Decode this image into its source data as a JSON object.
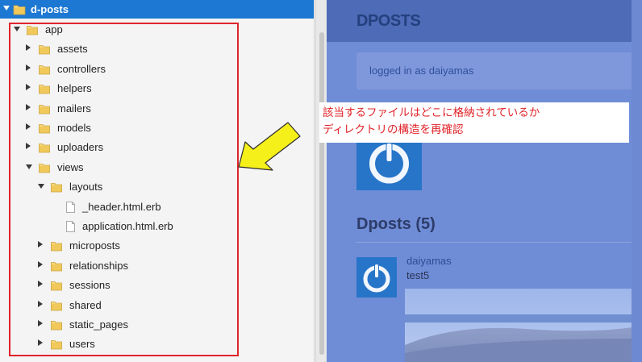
{
  "tree": {
    "root": {
      "label": "d-posts"
    },
    "nodes": [
      {
        "label": "app",
        "type": "folder",
        "depth": 0,
        "expanded": true
      },
      {
        "label": "assets",
        "type": "folder",
        "depth": 1,
        "expanded": false
      },
      {
        "label": "controllers",
        "type": "folder",
        "depth": 1,
        "expanded": false
      },
      {
        "label": "helpers",
        "type": "folder",
        "depth": 1,
        "expanded": false
      },
      {
        "label": "mailers",
        "type": "folder",
        "depth": 1,
        "expanded": false
      },
      {
        "label": "models",
        "type": "folder",
        "depth": 1,
        "expanded": false
      },
      {
        "label": "uploaders",
        "type": "folder",
        "depth": 1,
        "expanded": false
      },
      {
        "label": "views",
        "type": "folder",
        "depth": 1,
        "expanded": true
      },
      {
        "label": "layouts",
        "type": "folder",
        "depth": 2,
        "expanded": true
      },
      {
        "label": "_header.html.erb",
        "type": "file",
        "depth": 3
      },
      {
        "label": "application.html.erb",
        "type": "file",
        "depth": 3
      },
      {
        "label": "microposts",
        "type": "folder",
        "depth": 2,
        "expanded": false
      },
      {
        "label": "relationships",
        "type": "folder",
        "depth": 2,
        "expanded": false
      },
      {
        "label": "sessions",
        "type": "folder",
        "depth": 2,
        "expanded": false
      },
      {
        "label": "shared",
        "type": "folder",
        "depth": 2,
        "expanded": false
      },
      {
        "label": "static_pages",
        "type": "folder",
        "depth": 2,
        "expanded": false
      },
      {
        "label": "users",
        "type": "folder",
        "depth": 2,
        "expanded": false
      }
    ]
  },
  "annotation": {
    "line1": "該当するファイルはどこに格納されているか",
    "line2": "ディレクトリの構造を再確認",
    "color": "#e0242a",
    "arrow_color": "#f5ef1a"
  },
  "app_preview": {
    "brand": "DPOSTS",
    "banner": "logged in as daiyamas",
    "section_title": "Dposts (5)",
    "post": {
      "user": "daiyamas",
      "content": "test5"
    }
  },
  "colors": {
    "tree_header": "#1c78d2",
    "app_background": "#6f8cd6",
    "app_navbar": "#4d6bb6",
    "avatar": "#2775c8"
  }
}
